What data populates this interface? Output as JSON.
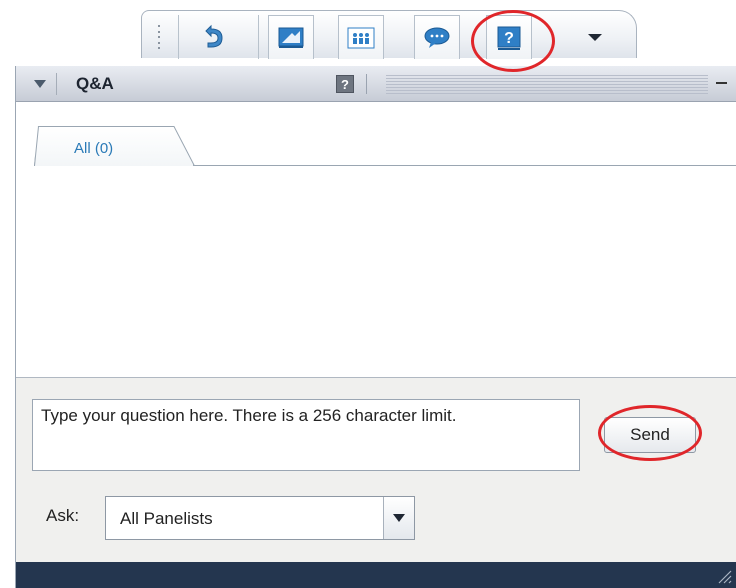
{
  "toolbar": {
    "buttons": [
      {
        "name": "grip-handle",
        "icon": "grip-dots-icon"
      },
      {
        "name": "undo-button",
        "icon": "undo-arrow-icon"
      },
      {
        "name": "share-button",
        "icon": "presentation-icon"
      },
      {
        "name": "participants-button",
        "icon": "participants-icon"
      },
      {
        "name": "chat-button",
        "icon": "chat-bubble-icon"
      },
      {
        "name": "qa-button",
        "icon": "question-mark-icon"
      },
      {
        "name": "more-button",
        "icon": "dropdown-arrow-icon"
      }
    ]
  },
  "panel": {
    "title": "Q&A",
    "help_glyph": "?",
    "tabs": [
      {
        "label": "All (0)",
        "active": true
      }
    ],
    "question_placeholder": "Type your question here. There is a 256 character limit.",
    "send_label": "Send",
    "ask_label": "Ask:",
    "ask_selected": "All Panelists"
  },
  "colors": {
    "accent_blue": "#2a7ab7",
    "footer": "#24364f",
    "highlight_red": "#e0262a"
  }
}
